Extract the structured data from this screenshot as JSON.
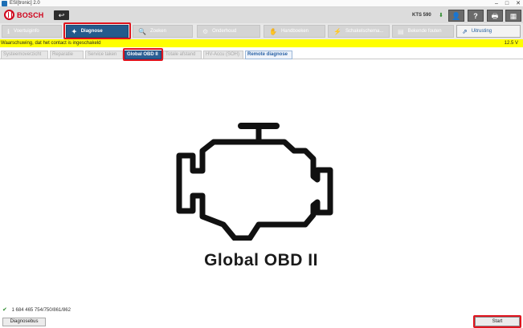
{
  "window": {
    "title": "ESI[tronic] 2.0",
    "controls": [
      "–",
      "□",
      "✕"
    ]
  },
  "header": {
    "brand": "BOSCH",
    "back_icon": "back-arrow-icon",
    "back_glyph": "↩",
    "device": "KTS 590",
    "icons": [
      {
        "name": "user-icon",
        "glyph": "👤"
      },
      {
        "name": "help-icon",
        "glyph": "?"
      },
      {
        "name": "print-icon",
        "glyph": "🖶"
      },
      {
        "name": "calculator-icon",
        "glyph": "▦"
      }
    ]
  },
  "nav": {
    "items": [
      {
        "label": "Voertuiginfo",
        "icon": "info-icon",
        "glyph": "ℹ"
      },
      {
        "label": "Diagnose",
        "icon": "diagnose-icon",
        "glyph": "✦"
      },
      {
        "label": "Zoeken",
        "icon": "search-icon",
        "glyph": "🔍"
      },
      {
        "label": "Onderhoud",
        "icon": "gears-icon",
        "glyph": "⚙"
      },
      {
        "label": "Handboeken",
        "icon": "hand-icon",
        "glyph": "✋"
      },
      {
        "label": "Schakelschema...",
        "icon": "schematic-icon",
        "glyph": "⚡"
      },
      {
        "label": "Bekende fouten",
        "icon": "document-icon",
        "glyph": "▤"
      },
      {
        "label": "Uitrusting",
        "icon": "share-icon",
        "glyph": "⇗"
      }
    ],
    "active": "Diagnose"
  },
  "warning": {
    "text": "Waarschuwing, dat het contact is ingeschakeld",
    "voltage": "12.5 V"
  },
  "subtabs": [
    "Systeemoverzicht",
    "Reparatie",
    "Service taken",
    "Global OBD II",
    "Totale afstand",
    "HV-Accu (SOH)",
    "Remote diagnose"
  ],
  "main": {
    "title": "Global OBD II",
    "icon": "engine-icon"
  },
  "footer": {
    "part_number": "1 684 465 754/750/861/862",
    "diagnosebus_label": "Diagnosebus",
    "start_label": "Start"
  },
  "colors": {
    "accent": "#245a8c",
    "warning": "#ffff00",
    "highlight": "#e0141e"
  }
}
